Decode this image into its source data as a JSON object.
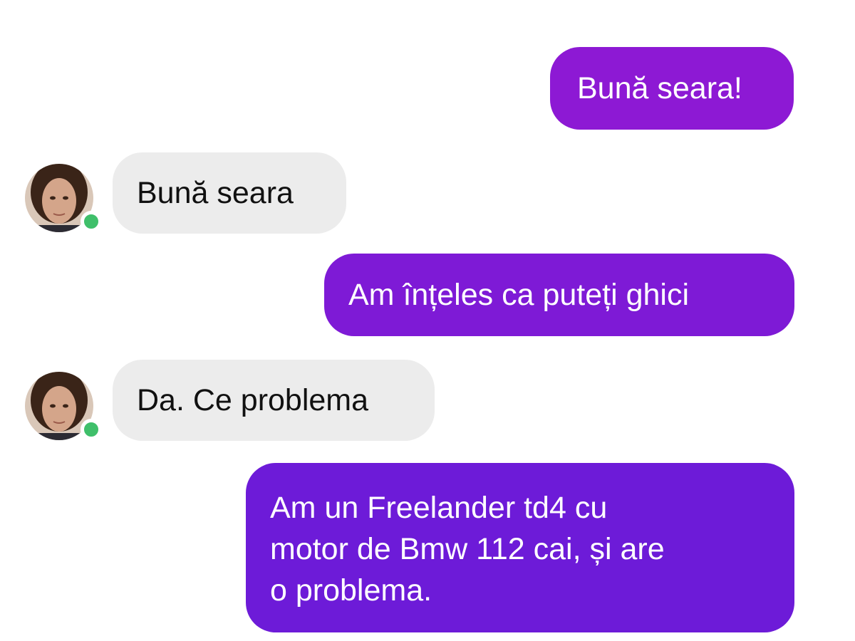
{
  "colors": {
    "sent_bubble": "#8a18d6",
    "sent_bubble_dark": "#6a1ad8",
    "received_bubble": "#ececec",
    "online_indicator": "#3fbf6a"
  },
  "contact": {
    "avatar_icon": "contact-avatar",
    "status": "online"
  },
  "messages": [
    {
      "side": "sent",
      "text": "Bună seara!"
    },
    {
      "side": "received",
      "text": "Bună seara"
    },
    {
      "side": "sent",
      "text": "Am înțeles ca puteți ghici"
    },
    {
      "side": "received",
      "text": "Da. Ce problema"
    },
    {
      "side": "sent",
      "lines": [
        "Am un Freelander td4 cu",
        "motor de Bmw 112 cai, și are",
        "o problema."
      ]
    }
  ]
}
